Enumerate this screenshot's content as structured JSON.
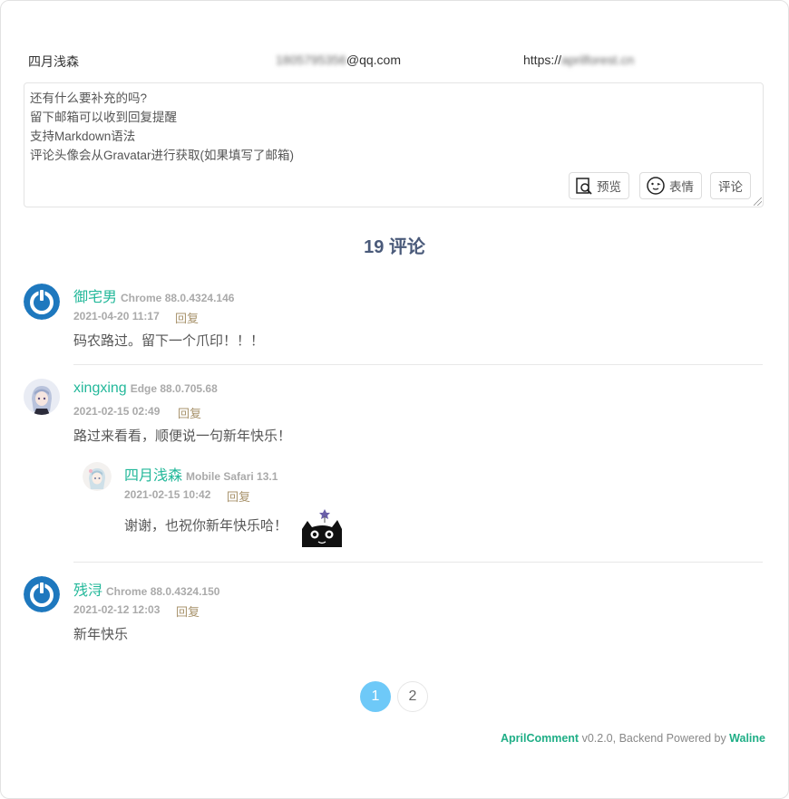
{
  "form": {
    "name_value": "四月浅森",
    "email_value": "1805795356@qq.com",
    "email_blurred_part": "1805795356",
    "email_domain": "@qq.com",
    "link_prefix": "https://",
    "link_blurred_part": "aprilforest.cn",
    "placeholder_lines": [
      "还有什么要补充的吗?",
      "留下邮箱可以收到回复提醒",
      "支持Markdown语法",
      "评论头像会从Gravatar进行获取(如果填写了邮箱)"
    ],
    "preview_label": "预览",
    "emoji_label": "表情",
    "submit_label": "评论"
  },
  "comment_count": "19 评论",
  "comments": [
    {
      "nick": "御宅男",
      "ua": "Chrome 88.0.4324.146",
      "time": "2021-04-20 11:17",
      "reply_label": "回复",
      "content": "码农路过。留下一个爪印！！！",
      "avatar": "default-power-avatar"
    },
    {
      "nick": "xingxing",
      "ua": "Edge 88.0.705.68",
      "time": "2021-02-15 02:49",
      "reply_label": "回复",
      "content": "路过来看看，顺便说一句新年快乐！",
      "avatar": "anime-avatar",
      "replies": [
        {
          "nick": "四月浅森",
          "ua": "Mobile Safari 13.1",
          "time": "2021-02-15 10:42",
          "reply_label": "回复",
          "content": "谢谢，也祝你新年快乐哈！",
          "avatar": "anime-avatar-small",
          "sticker": "black-cat-sticker"
        }
      ]
    },
    {
      "nick": "残浔",
      "ua": "Chrome 88.0.4324.150",
      "time": "2021-02-12 12:03",
      "reply_label": "回复",
      "content": "新年快乐",
      "avatar": "default-power-avatar"
    }
  ],
  "pagination": {
    "pages": [
      "1",
      "2"
    ],
    "current": "1"
  },
  "footer": {
    "brand": "AprilComment",
    "version_text": " v0.2.0, Backend Powered by ",
    "backend": "Waline"
  },
  "colors": {
    "nick": "#23b89a",
    "reply": "#a8936c",
    "active_page": "#6ec9f8",
    "title": "#4a5a7a"
  }
}
